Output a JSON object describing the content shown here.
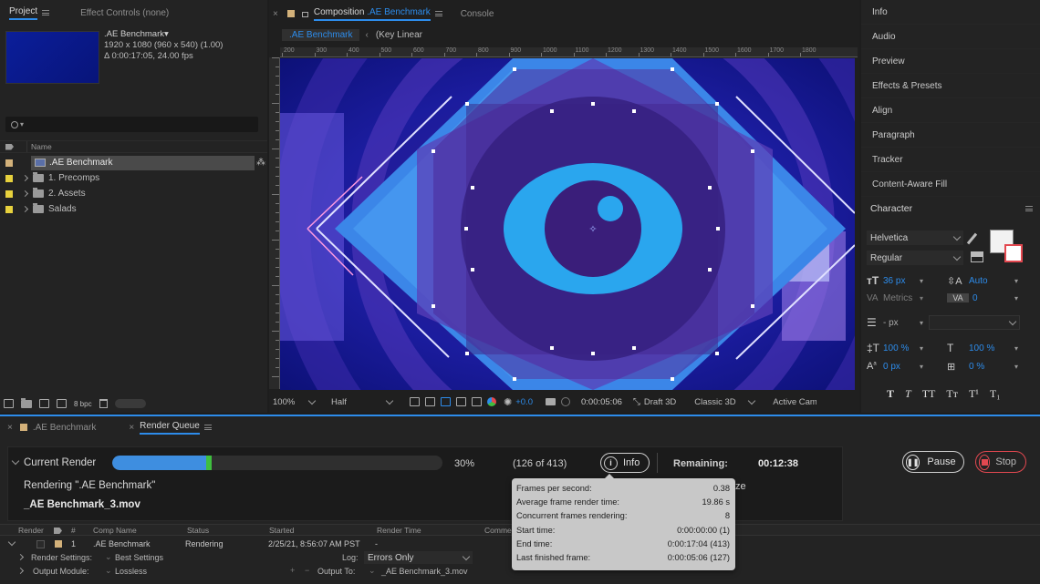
{
  "project_panel": {
    "tab_project": "Project",
    "tab_effect_controls": "Effect Controls (none)",
    "comp_name": ".AE Benchmark",
    "comp_info_line1": "1920 x 1080  (960 x 540) (1.00)",
    "comp_info_line2": "Δ 0:00:17:05, 24.00 fps",
    "search_placeholder": "",
    "col_name": "Name",
    "items": [
      {
        "label": ".AE Benchmark",
        "type": "comp",
        "color": "#d3b17a"
      },
      {
        "label": "1. Precomps",
        "type": "folder",
        "color": "#e7d13d"
      },
      {
        "label": "2. Assets",
        "type": "folder",
        "color": "#e7d13d"
      },
      {
        "label": "Salads",
        "type": "folder",
        "color": "#e7d13d"
      }
    ],
    "bpc": "8 bpc"
  },
  "composition_panel": {
    "tab_label": "Composition",
    "tab_comp_name": ".AE Benchmark",
    "tab_console": "Console",
    "crumb_current": ".AE Benchmark",
    "crumb_next": "Key Linear",
    "ruler_labels": [
      "200",
      "300",
      "400",
      "500",
      "600",
      "700",
      "800",
      "900",
      "1000",
      "1100",
      "1200",
      "1300",
      "1400",
      "1500",
      "1600",
      "1700",
      "1800"
    ],
    "zoom": "100%",
    "resolution": "Half",
    "exposure": "+0.0",
    "timecode": "0:00:05:06",
    "draft3d": "Draft 3D",
    "renderer": "Classic 3D",
    "active_camera": "Active Cam"
  },
  "right_panels": {
    "items": [
      "Info",
      "Audio",
      "Preview",
      "Effects & Presets",
      "Align",
      "Paragraph",
      "Tracker",
      "Content-Aware Fill"
    ],
    "character_title": "Character",
    "font_family": "Helvetica",
    "font_style": "Regular",
    "font_size": "36 px",
    "leading": "Auto",
    "kerning": "Metrics",
    "tracking": "0",
    "stroke_width": "- px",
    "vertical_scale": "100 %",
    "horizontal_scale": "100 %",
    "baseline_shift": "0 px",
    "tsume": "0 %",
    "style_buttons": [
      "T",
      "T",
      "TT",
      "Tт",
      "T¹",
      "T₁"
    ]
  },
  "bottom_tabs": {
    "tab1": ".AE Benchmark",
    "tab2": "Render Queue"
  },
  "render_queue": {
    "current_render_label": "Current Render",
    "progress_percent_text": "30%",
    "progress_value": 0.3,
    "frames_text": "(126 of 413)",
    "info_label": "Info",
    "remaining_label": "Remaining:",
    "remaining_value": "00:12:38",
    "pause_label": "Pause",
    "stop_label": "Stop",
    "rendering_line": "Rendering \".AE Benchmark\"",
    "output_file": "_AE Benchmark_3.mov",
    "columns": [
      "Render",
      "#",
      "Comp Name",
      "Status",
      "Started",
      "Render Time",
      "Comme"
    ],
    "row": {
      "num": "1",
      "comp": ".AE Benchmark",
      "status": "Rendering",
      "started": "2/25/21, 8:56:07 AM PST",
      "render_time": "-"
    },
    "render_settings_label": "Render Settings:",
    "render_settings_value": "Best Settings",
    "log_label": "Log:",
    "log_value": "Errors Only",
    "output_module_label": "Output Module:",
    "output_module_value": "Lossless",
    "output_to_label": "Output To:",
    "output_to_value": "_AE Benchmark_3.mov",
    "size_fragment": "ze"
  },
  "info_tooltip": {
    "rows": [
      {
        "label": "Frames per second:",
        "value": "0.38"
      },
      {
        "label": "Average frame render time:",
        "value": "19.86 s"
      },
      {
        "label": "Concurrent frames rendering:",
        "value": "8"
      },
      {
        "label": "Start time:",
        "value": "0:00:00:00 (1)"
      },
      {
        "label": "End time:",
        "value": "0:00:17:04 (413)"
      },
      {
        "label": "Last finished frame:",
        "value": "0:00:05:06 (127)"
      }
    ]
  },
  "colors": {
    "accent": "#2d8ceb",
    "progress_fill": "#3e8ee0",
    "progress_head": "#3fbf3f",
    "stop_red": "#e34850"
  }
}
